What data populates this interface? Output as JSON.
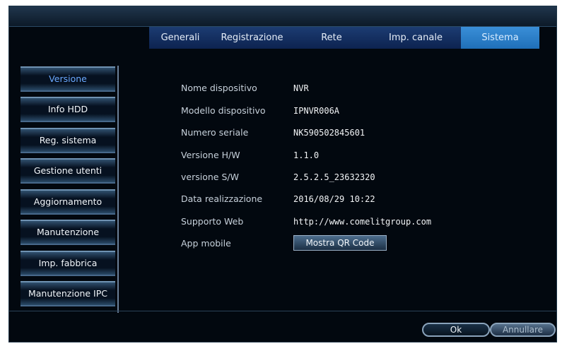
{
  "tabs": [
    {
      "label": "Generali"
    },
    {
      "label": "Registrazione"
    },
    {
      "label": "Rete"
    },
    {
      "label": "Imp. canale"
    },
    {
      "label": "Sistema",
      "active": true
    }
  ],
  "sidebar": {
    "items": [
      {
        "label": "Versione",
        "active": true
      },
      {
        "label": "Info HDD"
      },
      {
        "label": "Reg. sistema"
      },
      {
        "label": "Gestione utenti"
      },
      {
        "label": "Aggiornamento"
      },
      {
        "label": "Manutenzione"
      },
      {
        "label": "Imp. fabbrica"
      },
      {
        "label": "Manutenzione IPC"
      }
    ]
  },
  "info": [
    {
      "label": "Nome dispositivo",
      "value": "NVR"
    },
    {
      "label": "Modello dispositivo",
      "value": "IPNVR006A"
    },
    {
      "label": "Numero seriale",
      "value": "NK590502845601"
    },
    {
      "label": "Versione H/W",
      "value": "1.1.0"
    },
    {
      "label": "versione S/W",
      "value": "2.5.2.5_23632320"
    },
    {
      "label": "Data realizzazione",
      "value": "2016/08/29 10:22"
    },
    {
      "label": "Supporto Web",
      "value": "http://www.comelitgroup.com"
    },
    {
      "label": "App mobile"
    }
  ],
  "qr_button_label": "Mostra QR Code",
  "buttons": {
    "ok": "Ok",
    "cancel": "Annullare"
  },
  "colors": {
    "accent": "#2f86d0",
    "active_text": "#6aa9ff",
    "background": "#02080f"
  }
}
